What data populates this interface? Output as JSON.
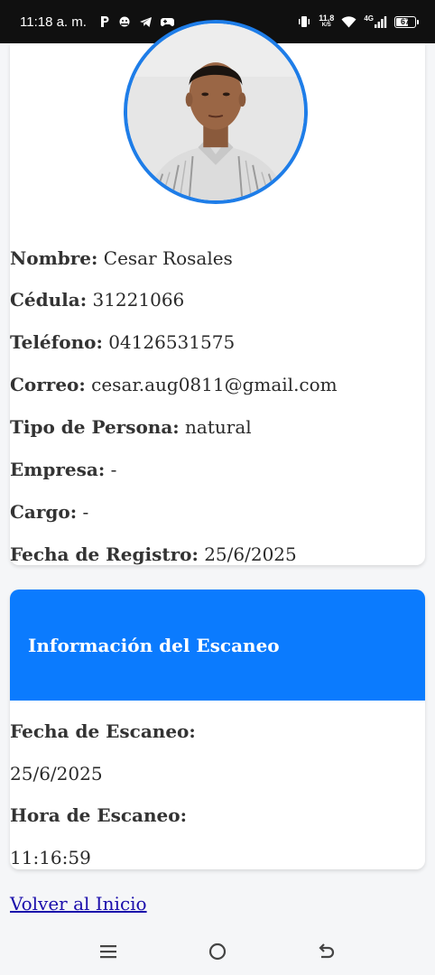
{
  "status_bar": {
    "time": "11:18 a. m.",
    "speed_value": "11,8",
    "speed_unit": "K/S",
    "network": "4G",
    "battery": "67",
    "battery_level": 0.67
  },
  "profile": {
    "fields": [
      {
        "label": "Nombre:",
        "value": "Cesar Rosales"
      },
      {
        "label": "Cédula:",
        "value": "31221066"
      },
      {
        "label": "Teléfono:",
        "value": "04126531575"
      },
      {
        "label": "Correo:",
        "value": "cesar.aug0811@gmail.com"
      },
      {
        "label": "Tipo de Persona:",
        "value": "natural"
      },
      {
        "label": "Empresa:",
        "value": "-"
      },
      {
        "label": "Cargo:",
        "value": "-"
      },
      {
        "label": "Fecha de Registro:",
        "value": "25/6/2025"
      }
    ]
  },
  "scan": {
    "title": "Información del Escaneo",
    "date_label": "Fecha de Escaneo:",
    "date_value": "25/6/2025",
    "time_label": "Hora de Escaneo:",
    "time_value": "11:16:59"
  },
  "back_link": "Volver al Inicio",
  "colors": {
    "accent": "#0b7bfe",
    "photo_border": "#1e7de8",
    "link": "#1a0dab"
  },
  "icons": {
    "nav": [
      "menu-icon",
      "home-icon",
      "back-icon"
    ],
    "status": [
      "parking-app-icon",
      "android-icon",
      "telegram-icon",
      "gamepad-icon",
      "vibrate-icon",
      "wifi-icon",
      "signal-icon",
      "battery-icon"
    ]
  }
}
